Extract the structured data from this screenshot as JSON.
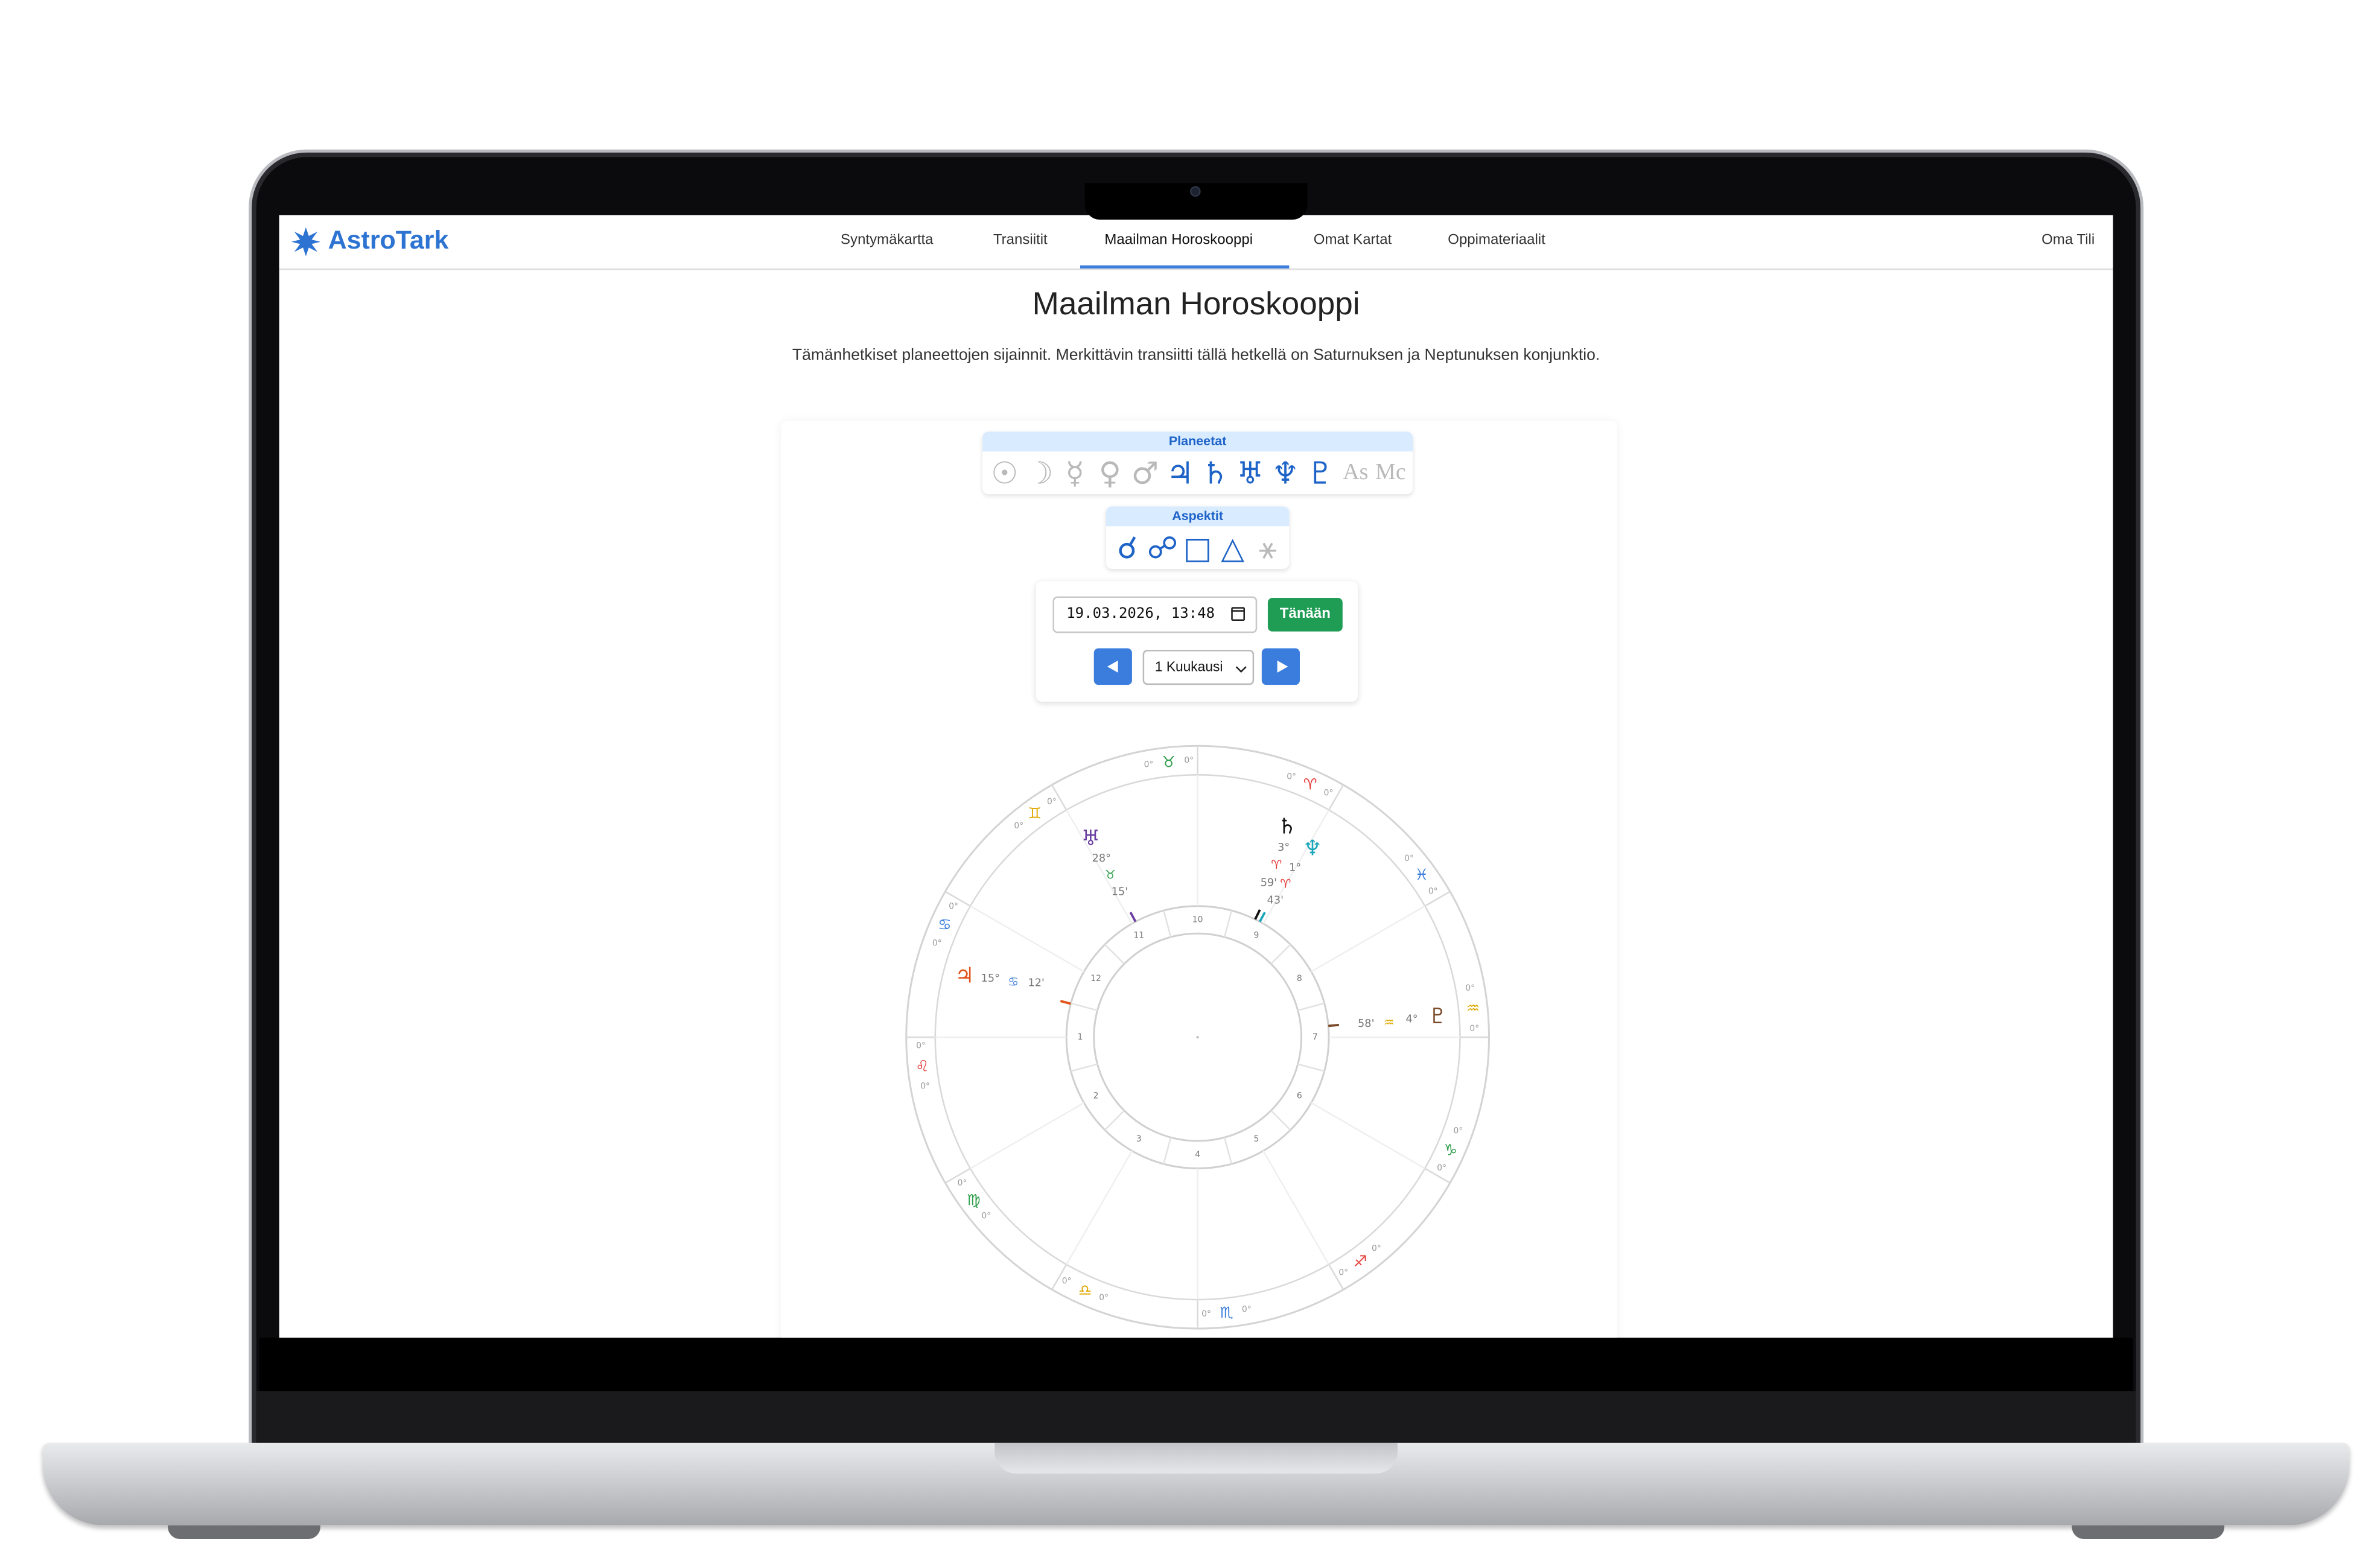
{
  "app": {
    "name": "AstroTark",
    "account_label": "Oma Tili",
    "colors": {
      "accent": "#3b7ddd",
      "logo": "#2c73d2",
      "today_button": "#1f9d55"
    }
  },
  "nav": {
    "items": [
      {
        "label": "Syntymäkartta",
        "active": false
      },
      {
        "label": "Transiitit",
        "active": false
      },
      {
        "label": "Maailman Horoskooppi",
        "active": true
      },
      {
        "label": "Omat Kartat",
        "active": false
      },
      {
        "label": "Oppimateriaalit",
        "active": false
      }
    ]
  },
  "page": {
    "title": "Maailman Horoskooppi",
    "description": "Tämänhetkiset planeettojen sijainnit. Merkittävin transiitti tällä hetkellä on Saturnuksen ja Neptunuksen konjunktio."
  },
  "filters": {
    "planets_label": "Planeetat",
    "planets": [
      {
        "name": "sun-icon",
        "glyph": "☉",
        "enabled": false
      },
      {
        "name": "moon-icon",
        "glyph": "☽",
        "enabled": false
      },
      {
        "name": "mercury-icon",
        "glyph": "☿",
        "enabled": false
      },
      {
        "name": "venus-icon",
        "glyph": "♀",
        "enabled": false
      },
      {
        "name": "mars-icon",
        "glyph": "♂",
        "enabled": false
      },
      {
        "name": "jupiter-icon",
        "glyph": "♃",
        "enabled": true
      },
      {
        "name": "saturn-icon",
        "glyph": "♄",
        "enabled": true
      },
      {
        "name": "uranus-icon",
        "glyph": "♅",
        "enabled": true
      },
      {
        "name": "neptune-icon",
        "glyph": "♆",
        "enabled": true
      },
      {
        "name": "pluto-icon",
        "glyph": "♇",
        "enabled": true
      },
      {
        "name": "ascendant-icon",
        "glyph": "As",
        "enabled": false
      },
      {
        "name": "midheaven-icon",
        "glyph": "Mc",
        "enabled": false
      }
    ],
    "aspects_label": "Aspektit",
    "aspects": [
      {
        "name": "conjunction-icon",
        "glyph": "☌",
        "enabled": true
      },
      {
        "name": "opposition-icon",
        "glyph": "☍",
        "enabled": true
      },
      {
        "name": "square-icon",
        "glyph": "□",
        "enabled": true
      },
      {
        "name": "trine-icon",
        "glyph": "△",
        "enabled": true
      },
      {
        "name": "sextile-icon",
        "glyph": "⚹",
        "enabled": false
      }
    ]
  },
  "controls": {
    "datetime_value": "19.03.2026, 13:48",
    "today_label": "Tänään",
    "step_value": "1 Kuukausi"
  },
  "chart": {
    "zodiac": [
      {
        "glyph": "♈",
        "label": "0°",
        "color": "#e53935"
      },
      {
        "glyph": "♉",
        "label": "0°",
        "color": "#2e9d4a"
      },
      {
        "glyph": "♊",
        "label": "0°",
        "color": "#e0a800"
      },
      {
        "glyph": "♋",
        "label": "0°",
        "color": "#3b7ddd"
      },
      {
        "glyph": "♌",
        "label": "0°",
        "color": "#e53935"
      },
      {
        "glyph": "♍",
        "label": "0°",
        "color": "#2e9d4a"
      },
      {
        "glyph": "♎",
        "label": "0°",
        "color": "#e0a800"
      },
      {
        "glyph": "♏",
        "label": "0°",
        "color": "#3b7ddd"
      },
      {
        "glyph": "♐",
        "label": "0°",
        "color": "#e53935"
      },
      {
        "glyph": "♑",
        "label": "0°",
        "color": "#2e9d4a"
      },
      {
        "glyph": "♒",
        "label": "0°",
        "color": "#e0a800"
      },
      {
        "glyph": "♓",
        "label": "0°",
        "color": "#3b7ddd"
      }
    ],
    "houses": [
      "1",
      "2",
      "3",
      "4",
      "5",
      "6",
      "7",
      "8",
      "9",
      "10",
      "11",
      "12"
    ],
    "planets": [
      {
        "name": "saturn",
        "glyph": "♄",
        "color": "#111111",
        "degree": "3°",
        "sign_glyph": "♈",
        "minutes": "59'"
      },
      {
        "name": "neptune",
        "glyph": "♆",
        "color": "#1aa5b8",
        "degree": "1°",
        "sign_glyph": "♈",
        "minutes": "43'"
      },
      {
        "name": "uranus",
        "glyph": "♅",
        "color": "#6a3fa0",
        "degree": "28°",
        "sign_glyph": "♉",
        "minutes": "15'"
      },
      {
        "name": "jupiter",
        "glyph": "♃",
        "color": "#e0541c",
        "degree": "15°",
        "sign_glyph": "♋",
        "minutes": "12'"
      },
      {
        "name": "pluto",
        "glyph": "♇",
        "color": "#7a4a2a",
        "degree": "4°",
        "sign_glyph": "♒",
        "minutes": "58'"
      }
    ]
  }
}
